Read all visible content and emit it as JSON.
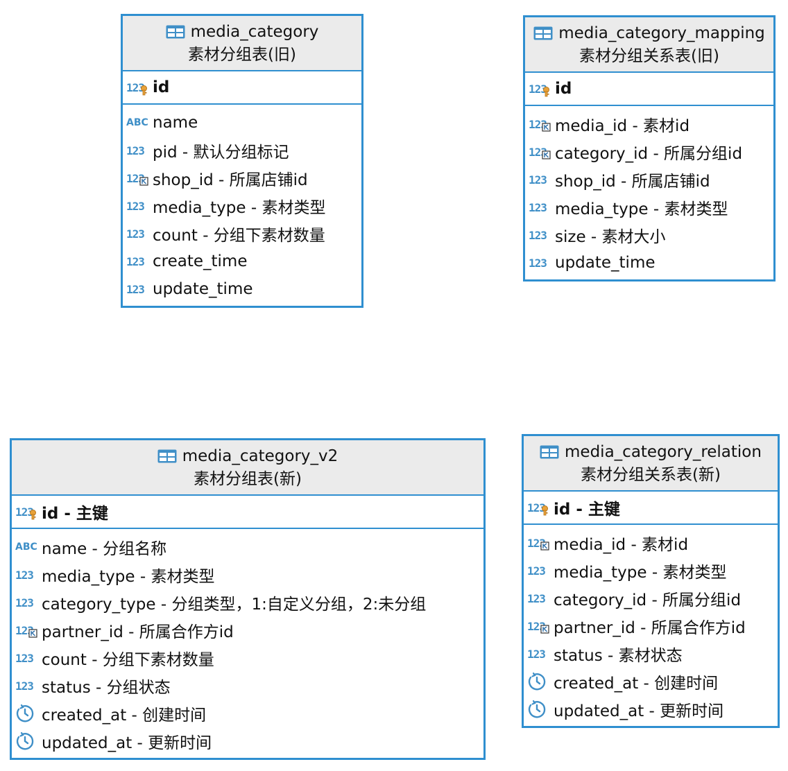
{
  "tables": [
    {
      "name": "media_category",
      "comment": "素材分组表(旧)",
      "pk": [
        {
          "type": "123",
          "key": "pk",
          "label": "id"
        }
      ],
      "columns": [
        {
          "type": "ABC",
          "label": "name"
        },
        {
          "type": "123",
          "label": "pid - 默认分组标记"
        },
        {
          "type": "123",
          "key": "fk",
          "label": "shop_id - 所属店铺id"
        },
        {
          "type": "123",
          "label": "media_type - 素材类型"
        },
        {
          "type": "123",
          "label": "count - 分组下素材数量"
        },
        {
          "type": "123",
          "label": "create_time"
        },
        {
          "type": "123",
          "label": "update_time"
        }
      ]
    },
    {
      "name": "media_category_mapping",
      "comment": "素材分组关系表(旧)",
      "pk": [
        {
          "type": "123",
          "key": "pk",
          "label": "id"
        }
      ],
      "columns": [
        {
          "type": "123",
          "key": "fk",
          "label": "media_id - 素材id"
        },
        {
          "type": "123",
          "key": "fk",
          "label": "category_id - 所属分组id"
        },
        {
          "type": "123",
          "label": "shop_id - 所属店铺id"
        },
        {
          "type": "123",
          "label": "media_type - 素材类型"
        },
        {
          "type": "123",
          "label": "size - 素材大小"
        },
        {
          "type": "123",
          "label": "update_time"
        }
      ]
    },
    {
      "name": "media_category_v2",
      "comment": "素材分组表(新)",
      "pk": [
        {
          "type": "123",
          "key": "pk",
          "label": "id - 主键"
        }
      ],
      "columns": [
        {
          "type": "ABC",
          "label": "name - 分组名称"
        },
        {
          "type": "123",
          "label": "media_type - 素材类型"
        },
        {
          "type": "123",
          "label": "category_type - 分组类型，1:自定义分组，2:未分组"
        },
        {
          "type": "123",
          "key": "fk",
          "label": "partner_id - 所属合作方id"
        },
        {
          "type": "123",
          "label": "count - 分组下素材数量"
        },
        {
          "type": "123",
          "label": "status - 分组状态"
        },
        {
          "type": "clock",
          "label": "created_at - 创建时间"
        },
        {
          "type": "clock",
          "label": "updated_at - 更新时间"
        }
      ]
    },
    {
      "name": "media_category_relation",
      "comment": "素材分组关系表(新)",
      "pk": [
        {
          "type": "123",
          "key": "pk",
          "label": "id - 主键"
        }
      ],
      "columns": [
        {
          "type": "123",
          "key": "fk",
          "label": "media_id - 素材id"
        },
        {
          "type": "123",
          "label": "media_type - 素材类型"
        },
        {
          "type": "123",
          "label": "category_id - 所属分组id"
        },
        {
          "type": "123",
          "key": "fk",
          "label": "partner_id - 所属合作方id"
        },
        {
          "type": "123",
          "label": "status - 素材状态"
        },
        {
          "type": "clock",
          "label": "created_at - 创建时间"
        },
        {
          "type": "clock",
          "label": "updated_at - 更新时间"
        }
      ]
    }
  ],
  "colors": {
    "border": "#2f8fd0",
    "header_bg": "#ebebeb",
    "type_icon": "#3f8fc7",
    "pk_key": "#e8a23a"
  }
}
